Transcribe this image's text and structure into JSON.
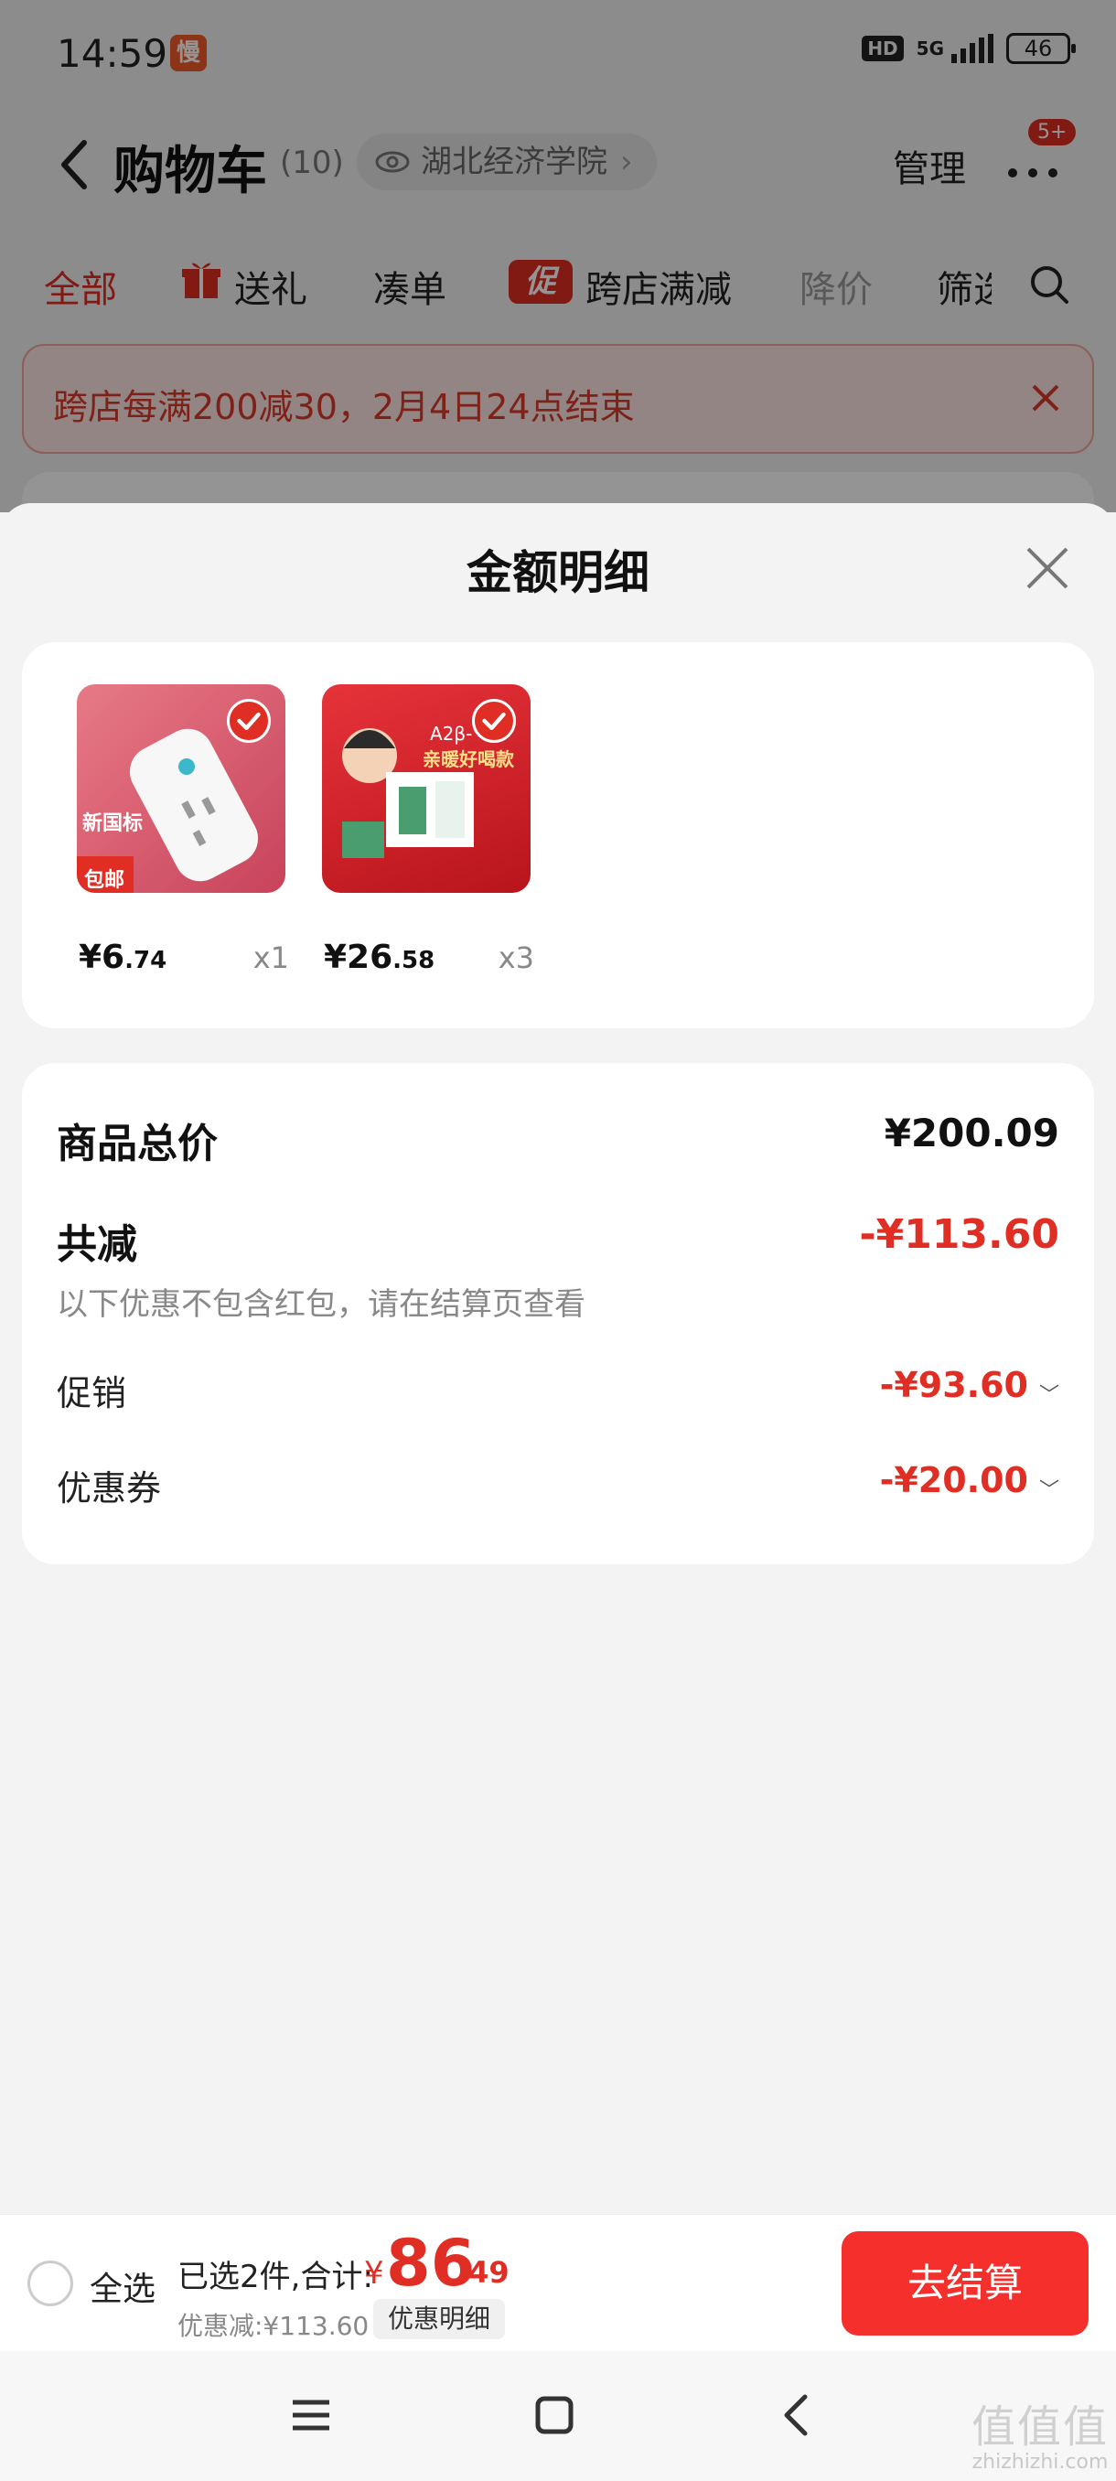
{
  "status_bar": {
    "time": "14:59",
    "app_badge": "慢",
    "hd": "HD",
    "network": "5G",
    "battery": "46"
  },
  "header": {
    "title": "购物车",
    "count": "(10)",
    "location": "湖北经济学院",
    "manage": "管理",
    "notif_badge": "5+"
  },
  "tabs": [
    {
      "label": "全部"
    },
    {
      "label": "送礼"
    },
    {
      "label": "凑单"
    },
    {
      "label": "跨店满减"
    },
    {
      "label": "降价"
    },
    {
      "label": "筛选"
    }
  ],
  "promo_icon_label": "促",
  "promo_banner": {
    "text": "跨店每满200减30，2月4日24点结束"
  },
  "sheet": {
    "title": "金额明细",
    "products": [
      {
        "price_int": "¥6",
        "price_dec": ".74",
        "qty": "x1",
        "image_caption": "新国标",
        "image_tag": "包邮"
      },
      {
        "price_int": "¥26",
        "price_dec": ".58",
        "qty": "x3",
        "image_caption": "A2β-",
        "image_tag": "亲暖好喝款"
      }
    ],
    "summary": {
      "total_label": "商品总价",
      "total_value": "¥200.09",
      "reduce_label": "共减",
      "reduce_value": "-¥113.60",
      "note": "以下优惠不包含红包，请在结算页查看",
      "promo_label": "促销",
      "promo_value": "-¥93.60",
      "coupon_label": "优惠券",
      "coupon_value": "-¥20.00"
    }
  },
  "bottom_bar": {
    "select_all": "全选",
    "selected_text": "已选2件,合计:",
    "currency": "¥",
    "total_int": "86",
    "total_dec": ".49",
    "discount": "优惠减:¥113.60",
    "detail": "优惠明细",
    "checkout": "去结算"
  },
  "watermark": {
    "line1": "值值值",
    "line2": "zhizhizhi.com"
  },
  "colors": {
    "accent": "#e02e24",
    "checkout": "#f5302c"
  }
}
